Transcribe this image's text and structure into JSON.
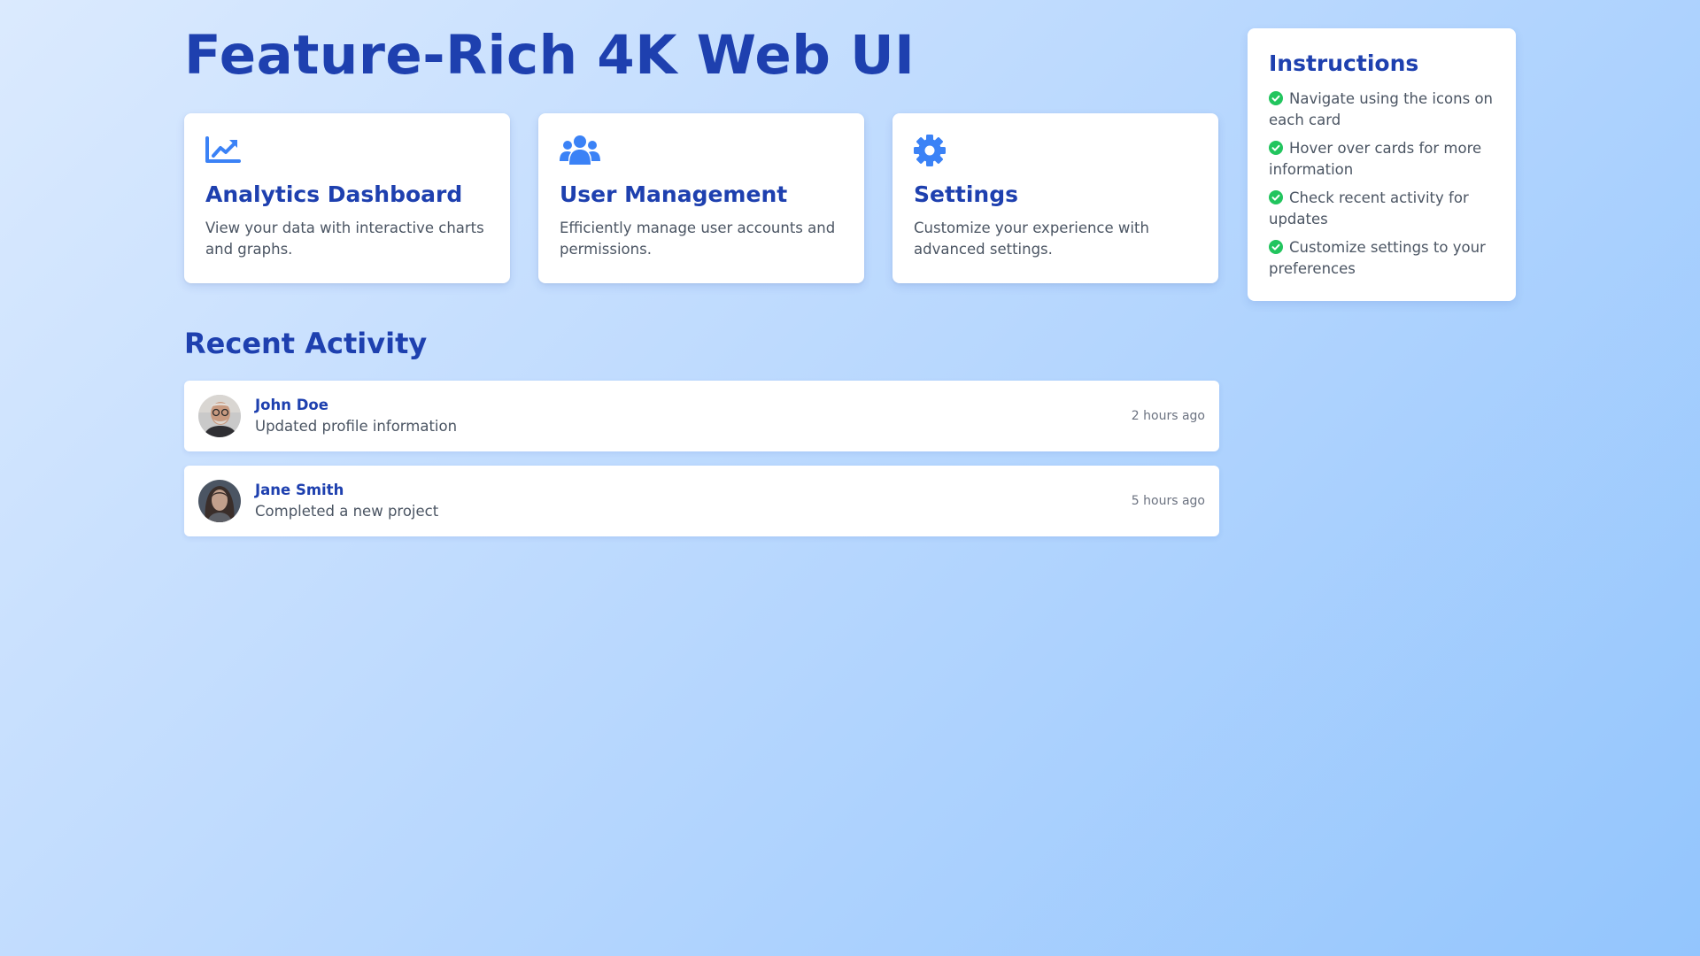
{
  "page": {
    "title": "Feature-Rich 4K Web UI"
  },
  "cards": [
    {
      "icon": "chart-line-icon",
      "title": "Analytics Dashboard",
      "description": "View your data with interactive charts and graphs."
    },
    {
      "icon": "users-icon",
      "title": "User Management",
      "description": "Efficiently manage user accounts and permissions."
    },
    {
      "icon": "gear-icon",
      "title": "Settings",
      "description": "Customize your experience with advanced settings."
    }
  ],
  "recent_activity": {
    "title": "Recent Activity",
    "items": [
      {
        "name": "John Doe",
        "action": "Updated profile information",
        "time": "2 hours ago"
      },
      {
        "name": "Jane Smith",
        "action": "Completed a new project",
        "time": "5 hours ago"
      }
    ]
  },
  "instructions": {
    "title": "Instructions",
    "items": [
      "Navigate using the icons on each card",
      "Hover over cards for more information",
      "Check recent activity for updates",
      "Customize settings to your preferences"
    ]
  },
  "colors": {
    "accent": "#1e40af",
    "icon": "#3b82f6",
    "check": "#22c55e",
    "body_text": "#4b5563",
    "muted_text": "#6b7280"
  }
}
